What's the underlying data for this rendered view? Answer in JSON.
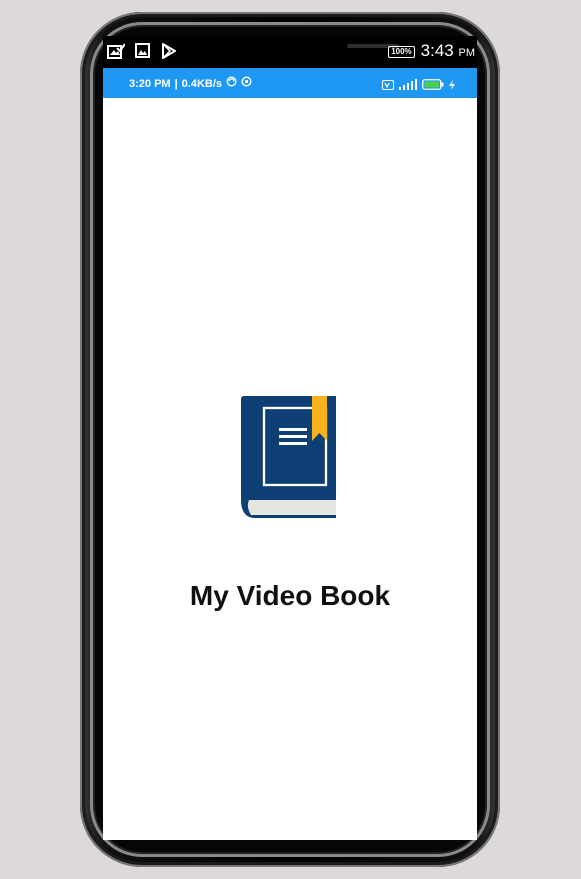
{
  "device": {
    "outer_status": {
      "battery_percent": "100%",
      "time": "3:43",
      "ampm": "PM",
      "left_icons": [
        "gallery-check-icon",
        "image-icon",
        "play-store-icon"
      ]
    },
    "inner_status": {
      "time": "3:20 PM",
      "separator": "|",
      "speed": "0.4KB/s",
      "right_icons": [
        "volte-icon",
        "signal-icon",
        "battery-icon",
        "charging-icon"
      ]
    }
  },
  "splash": {
    "icon": "book-icon",
    "title": "My Video Book",
    "colors": {
      "status_bar": "#1e98f2",
      "book_cover": "#0e3f74",
      "bookmark": "#f5b21b",
      "pages": "#e6e6e0"
    }
  }
}
